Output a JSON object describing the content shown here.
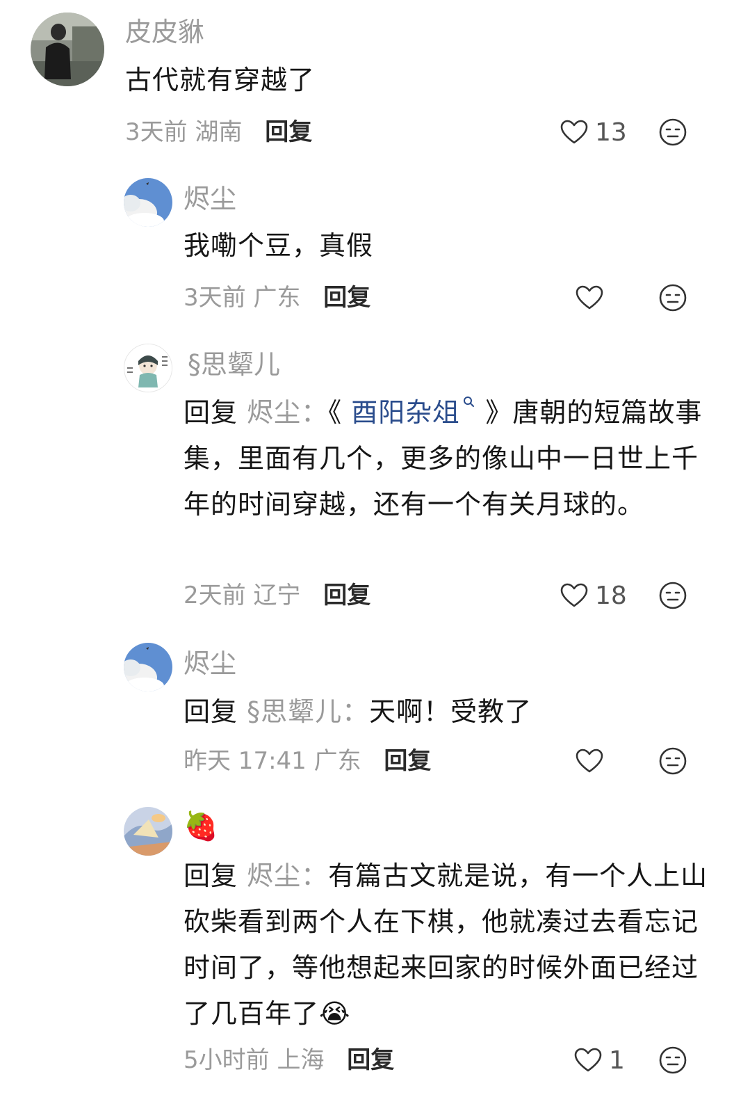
{
  "comments": [
    {
      "username": "皮皮貅",
      "text": "古代就有穿越了",
      "time": "3天前",
      "location": "湖南",
      "reply_label": "回复",
      "like_count": "13"
    },
    {
      "username": "烬尘",
      "text": "我嘞个豆，真假",
      "time": "3天前",
      "location": "广东",
      "reply_label": "回复",
      "like_count": ""
    },
    {
      "username": "§思颦儿",
      "reply_prefix": "回复",
      "reply_target": "烬尘：",
      "text_before_link": "《",
      "link_text": "酉阳杂俎",
      "text_after_link": "》唐朝的短篇故事集，里面有几个，更多的像山中一日世上千年的时间穿越，还有一个有关月球的。",
      "time": "2天前",
      "location": "辽宁",
      "reply_label": "回复",
      "like_count": "18"
    },
    {
      "username": "烬尘",
      "reply_prefix": "回复",
      "reply_target": "§思颦儿：",
      "text": "天啊！受教了",
      "time": "昨天 17:41",
      "location": "广东",
      "reply_label": "回复",
      "like_count": ""
    },
    {
      "username": "🍓",
      "reply_prefix": "回复",
      "reply_target": "烬尘：",
      "text": "有篇古文就是说，有一个人上山砍柴看到两个人在下棋，他就凑过去看忘记时间了，等他想起来回家的时候外面已经过了几百年了😭",
      "time": "5小时前",
      "location": "上海",
      "reply_label": "回复",
      "like_count": "1"
    }
  ],
  "icons": {
    "like": "heart-outline-icon",
    "dislike": "neutral-face-icon",
    "link": "search-icon"
  },
  "colors": {
    "muted": "#9a9a9a",
    "link": "#2a4c8c",
    "text": "#161616"
  }
}
